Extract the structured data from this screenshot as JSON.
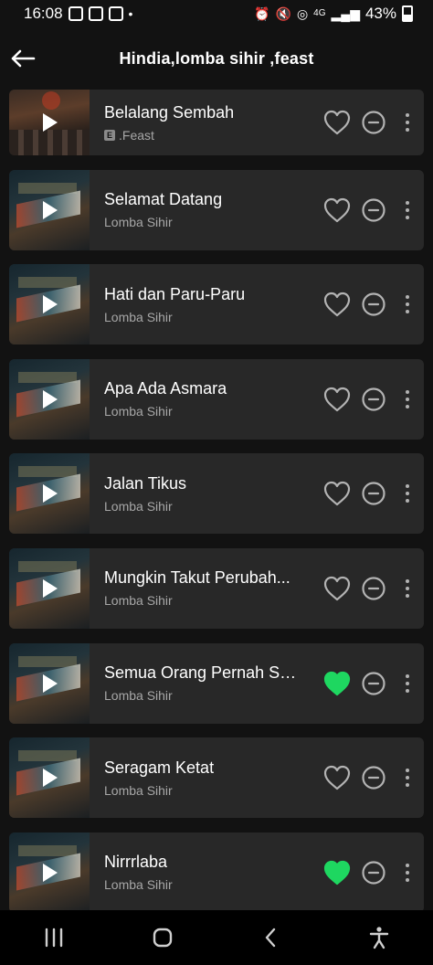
{
  "status_bar": {
    "time": "16:08",
    "network": "4G",
    "battery": "43%"
  },
  "header": {
    "title": "Hindia,lomba sihir ,feast"
  },
  "tracks": [
    {
      "title": "Belalang Sembah",
      "artist": ".Feast",
      "explicit": true,
      "explicit_label": "E",
      "liked": false
    },
    {
      "title": "Selamat Datang",
      "artist": "Lomba Sihir",
      "explicit": false,
      "liked": false
    },
    {
      "title": "Hati dan Paru-Paru",
      "artist": "Lomba Sihir",
      "explicit": false,
      "liked": false
    },
    {
      "title": "Apa Ada Asmara",
      "artist": "Lomba Sihir",
      "explicit": false,
      "liked": false
    },
    {
      "title": "Jalan Tikus",
      "artist": "Lomba Sihir",
      "explicit": false,
      "liked": false
    },
    {
      "title": "Mungkin Takut Perubah...",
      "artist": "Lomba Sihir",
      "explicit": false,
      "liked": false
    },
    {
      "title": "Semua Orang Pernah Sa...",
      "artist": "Lomba Sihir",
      "explicit": false,
      "liked": true
    },
    {
      "title": "Seragam Ketat",
      "artist": "Lomba Sihir",
      "explicit": false,
      "liked": false
    },
    {
      "title": "Nirrrlaba",
      "artist": "Lomba Sihir",
      "explicit": false,
      "liked": true
    }
  ],
  "colors": {
    "background": "#121212",
    "card": "#282828",
    "liked": "#1ed760",
    "icon": "#b3b3b3",
    "subtext": "#a7a7a7"
  },
  "icons": {
    "back": "arrow-left-icon",
    "like": "heart-icon",
    "remove": "minus-circle-icon",
    "more": "more-vertical-icon",
    "nav_recent": "recent-apps-icon",
    "nav_home": "home-icon",
    "nav_back": "back-icon",
    "nav_accessibility": "accessibility-icon"
  }
}
